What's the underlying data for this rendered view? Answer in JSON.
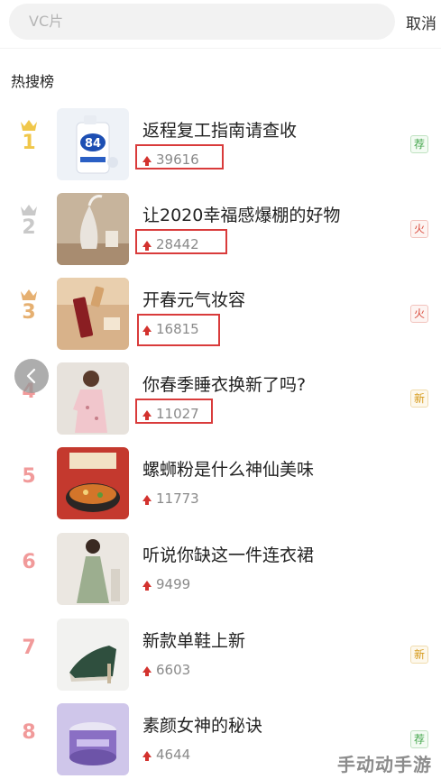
{
  "search": {
    "placeholder": "VC片",
    "cancel_label": "取消"
  },
  "section": {
    "title": "热搜榜"
  },
  "items": [
    {
      "rank": "1",
      "title": "返程复工指南请查收",
      "count": "39616",
      "badge": "荐",
      "badge_color": "#44a64c",
      "rank_color": "#f0c74a",
      "crown": true,
      "highlighted": true
    },
    {
      "rank": "2",
      "title": "让2020幸福感爆棚的好物",
      "count": "28442",
      "badge": "火",
      "badge_color": "#d94a3c",
      "rank_color": "#c9c9c9",
      "crown": true,
      "highlighted": true
    },
    {
      "rank": "3",
      "title": "开春元气妆容",
      "count": "16815",
      "badge": "火",
      "badge_color": "#d94a3c",
      "rank_color": "#e6b071",
      "crown": true,
      "highlighted": true
    },
    {
      "rank": "4",
      "title": "你春季睡衣换新了吗?",
      "count": "11027",
      "badge": "新",
      "badge_color": "#d69a1a",
      "rank_color": "#f19a9a",
      "crown": false,
      "highlighted": true
    },
    {
      "rank": "5",
      "title": "螺蛳粉是什么神仙美味",
      "count": "11773",
      "badge": "",
      "rank_color": "#f19a9a",
      "crown": false,
      "highlighted": false
    },
    {
      "rank": "6",
      "title": "听说你缺这一件连衣裙",
      "count": "9499",
      "badge": "",
      "rank_color": "#f19a9a",
      "crown": false,
      "highlighted": false
    },
    {
      "rank": "7",
      "title": "新款单鞋上新",
      "count": "6603",
      "badge": "新",
      "badge_color": "#d69a1a",
      "rank_color": "#f19a9a",
      "crown": false,
      "highlighted": false
    },
    {
      "rank": "8",
      "title": "素颜女神的秘诀",
      "count": "4644",
      "badge": "荐",
      "badge_color": "#44a64c",
      "rank_color": "#f19a9a",
      "crown": false,
      "highlighted": false
    }
  ],
  "overlay": {
    "back_icon": "chevron-left-icon"
  },
  "watermark": {
    "text": "手动动手游"
  }
}
